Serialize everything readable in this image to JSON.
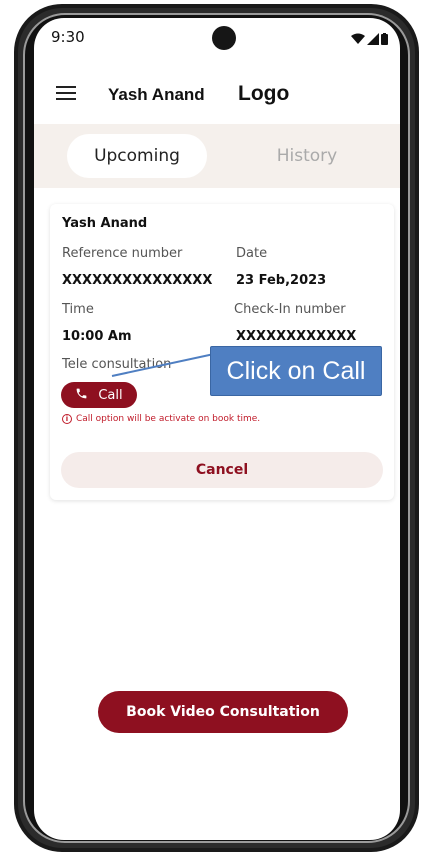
{
  "status": {
    "time": "9:30"
  },
  "header": {
    "user_name": "Yash Anand",
    "logo_text": "Logo"
  },
  "tabs": [
    {
      "label": "Upcoming",
      "active": true
    },
    {
      "label": "History",
      "active": false
    }
  ],
  "appointment": {
    "patient_name": "Yash Anand",
    "reference_label": "Reference number",
    "reference_value": "XXXXXXXXXXXXXXX",
    "date_label": "Date",
    "date_value": "23 Feb,2023",
    "time_label": "Time",
    "time_value": "10:00 Am",
    "checkin_label": "Check-In number",
    "checkin_value": "XXXXXXXXXXXX",
    "type_label": "Tele consultation",
    "call_label": "Call",
    "call_note": "Call option will be activate on book time.",
    "cancel_label": "Cancel"
  },
  "footer": {
    "book_label": "Book Video Consultation"
  },
  "annotation": {
    "text": "Click on Call"
  },
  "colors": {
    "primary": "#8e1020",
    "callout": "#4f7fc2",
    "tab_band": "#f5f0ec",
    "error": "#c01b2a"
  }
}
